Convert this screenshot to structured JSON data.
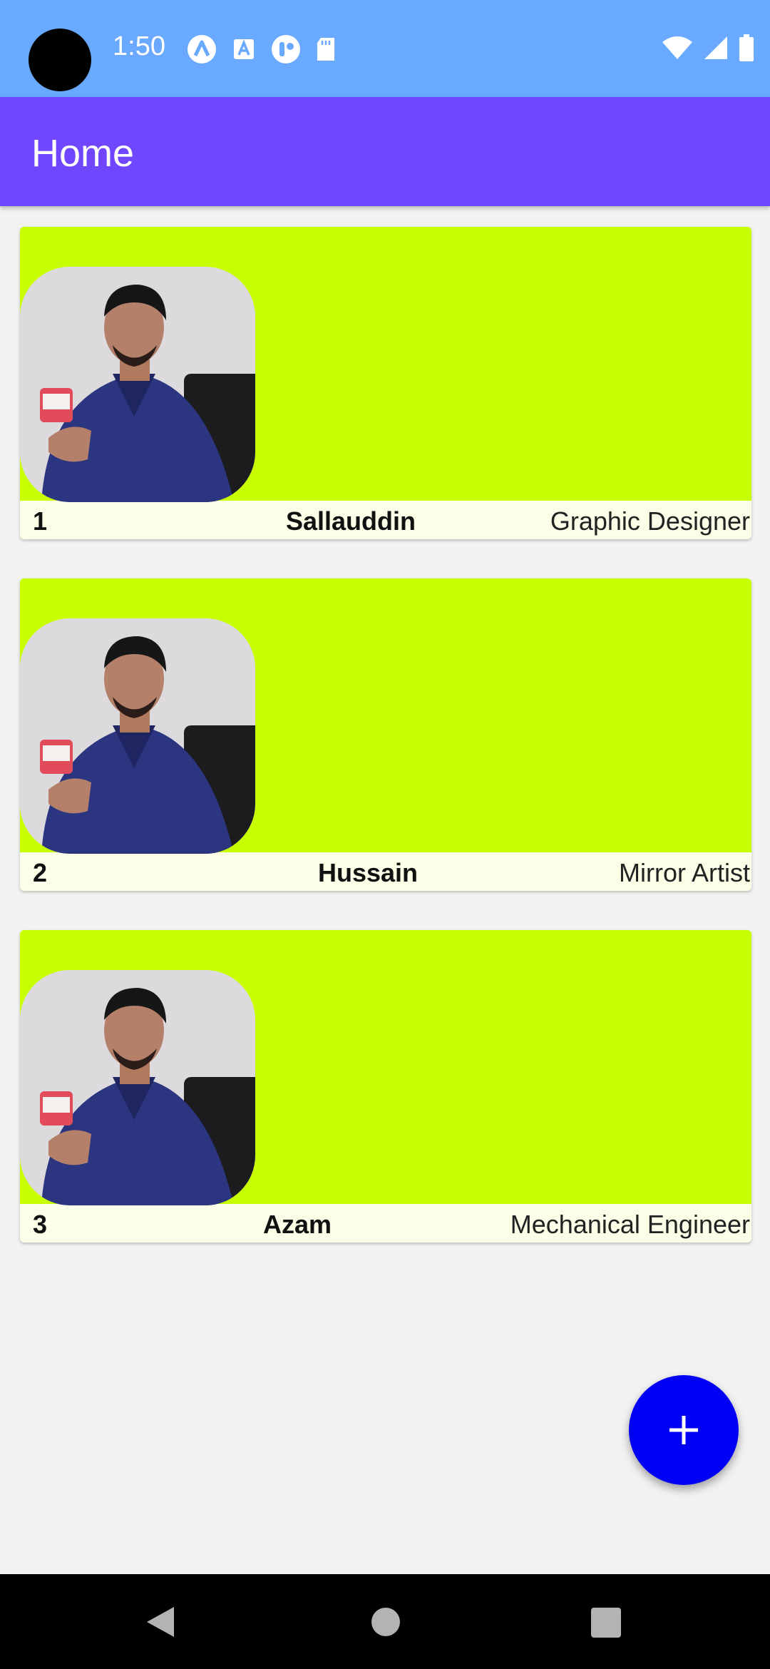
{
  "status_bar": {
    "time": "1:50",
    "left_icons": [
      "a-logo-icon",
      "font-a-icon",
      "pill-icon",
      "sd-card-icon"
    ],
    "right_icons": [
      "wifi-icon",
      "signal-icon",
      "battery-icon"
    ],
    "background": "#69a9ff"
  },
  "app_bar": {
    "title": "Home",
    "background": "#7046ff"
  },
  "cards": [
    {
      "number": "1",
      "name": "Sallauddin",
      "role": "Graphic Designer"
    },
    {
      "number": "2",
      "name": "Hussain",
      "role": "Mirror Artist"
    },
    {
      "number": "3",
      "name": "Azam",
      "role": "Mechanical Engineer"
    }
  ],
  "colors": {
    "card_top": "#c8ff00",
    "card_footer": "#fbffe8",
    "fab": "#0000f5"
  },
  "fab": {
    "icon": "plus-icon"
  },
  "nav_bar": {
    "icons": [
      "back-icon",
      "home-icon",
      "recents-icon"
    ]
  }
}
